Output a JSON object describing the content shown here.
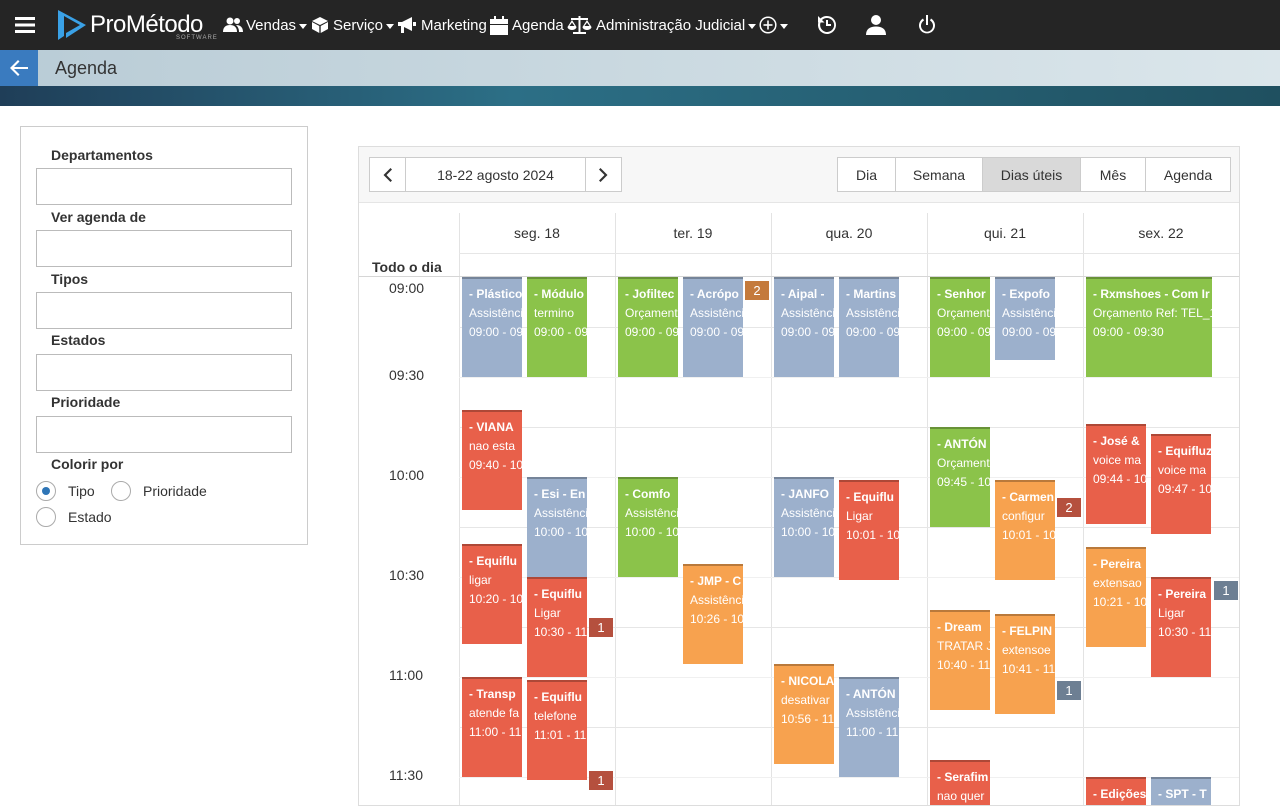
{
  "nav": {
    "brand": "ProMétodo",
    "brand_tag": "SOFTWARE",
    "items": [
      {
        "label": "Vendas"
      },
      {
        "label": "Serviço"
      },
      {
        "label": "Marketing"
      },
      {
        "label": "Agenda"
      },
      {
        "label": "Administração Judicial"
      }
    ]
  },
  "page": {
    "title": "Agenda"
  },
  "filters": {
    "departamentos": "Departamentos",
    "ver_agenda": "Ver agenda de",
    "tipos": "Tipos",
    "estados": "Estados",
    "prioridade": "Prioridade",
    "colorir_por": "Colorir por",
    "options": [
      "Tipo",
      "Prioridade",
      "Estado"
    ],
    "selected": "Tipo"
  },
  "calendar": {
    "date_range": "18-22 agosto 2024",
    "views": [
      "Dia",
      "Semana",
      "Dias úteis",
      "Mês",
      "Agenda"
    ],
    "active_view": "Dias úteis",
    "days": [
      "seg. 18",
      "ter. 19",
      "qua. 20",
      "qui. 21",
      "sex. 22"
    ],
    "all_day_label": "Todo o dia",
    "times": [
      "09:00",
      "09:30",
      "10:00",
      "10:30",
      "11:00",
      "11:30"
    ],
    "events": [
      {
        "title": "- Plástico",
        "desc": "Assistência",
        "time": "09:00 - 09"
      },
      {
        "title": "- Módulo",
        "desc": "termino",
        "time": "09:00 - 09"
      },
      {
        "title": "- Jofiltec",
        "desc": "Orçamento",
        "time": "09:00 - 09"
      },
      {
        "title": "- Acrópo",
        "desc": "Assistência",
        "time": "09:00 - 09"
      },
      {
        "title": "- Aipal -",
        "desc": "Assistência",
        "time": "09:00 - 09"
      },
      {
        "title": "- Martins",
        "desc": "Assistência",
        "time": "09:00 - 09"
      },
      {
        "title": "- Senhor",
        "desc": "Orçamento",
        "time": "09:00 - 09"
      },
      {
        "title": "- Expofo",
        "desc": "Assistência",
        "time": "09:00 - 09"
      },
      {
        "title": "- Rxmshoes - Com Ir",
        "desc": "Orçamento Ref: TEL_1",
        "time": "09:00 - 09:30"
      },
      {
        "title": "- VIANA",
        "desc": "nao esta",
        "time": "09:40 - 10"
      },
      {
        "title": "- Esi - En",
        "desc": "Assistência",
        "time": "10:00 - 10"
      },
      {
        "title": "- Equiflu",
        "desc": "ligar",
        "time": "10:20 - 10"
      },
      {
        "title": "- Equiflu",
        "desc": "Ligar",
        "time": "10:30 - 11"
      },
      {
        "title": "- Transp",
        "desc": "atende fa",
        "time": "11:00 - 11"
      },
      {
        "title": "- Equiflu",
        "desc": "telefone",
        "time": "11:01 - 11"
      },
      {
        "title": "- Comfo",
        "desc": "Assistência",
        "time": "10:00 - 10"
      },
      {
        "title": "- JMP - C",
        "desc": "Assistência",
        "time": "10:26 - 10"
      },
      {
        "title": "- JANFO",
        "desc": "Assistência",
        "time": "10:00 - 10"
      },
      {
        "title": "- Equiflu",
        "desc": "Ligar",
        "time": "10:01 - 10"
      },
      {
        "title": "- NICOLA",
        "desc": "desativar",
        "time": "10:56 - 11"
      },
      {
        "title": "- ANTÓN",
        "desc": "Assistência",
        "time": "11:00 - 11"
      },
      {
        "title": "- ANTÓN",
        "desc": "Orçamento",
        "time": "09:45 - 10"
      },
      {
        "title": "- Carmen",
        "desc": "configur",
        "time": "10:01 - 10"
      },
      {
        "title": "- Dream",
        "desc": "TRATAR J",
        "time": "10:40 - 11"
      },
      {
        "title": "- FELPIN",
        "desc": "extensoe",
        "time": "10:41 - 11"
      },
      {
        "title": "- Serafim",
        "desc": "nao quer",
        "time": ""
      },
      {
        "title": "- José &",
        "desc": "voice ma",
        "time": "09:44 - 10"
      },
      {
        "title": "- Equifluz",
        "desc": "voice ma",
        "time": "09:47 - 10"
      },
      {
        "title": "- Pereira",
        "desc": "extensao",
        "time": "10:21 - 10"
      },
      {
        "title": "- Pereira",
        "desc": "Ligar",
        "time": "10:30 - 11"
      },
      {
        "title": "- Edições",
        "desc": "",
        "time": ""
      },
      {
        "title": "- SPT - T",
        "desc": "",
        "time": ""
      }
    ],
    "badges": [
      "2",
      "1",
      "1",
      "2",
      "1",
      "1"
    ]
  },
  "colors": {
    "green": "#8bc34a",
    "blue": "#9cb0cc",
    "red": "#e8604a",
    "orange": "#f7a24f",
    "accent": "#2e75b6"
  }
}
